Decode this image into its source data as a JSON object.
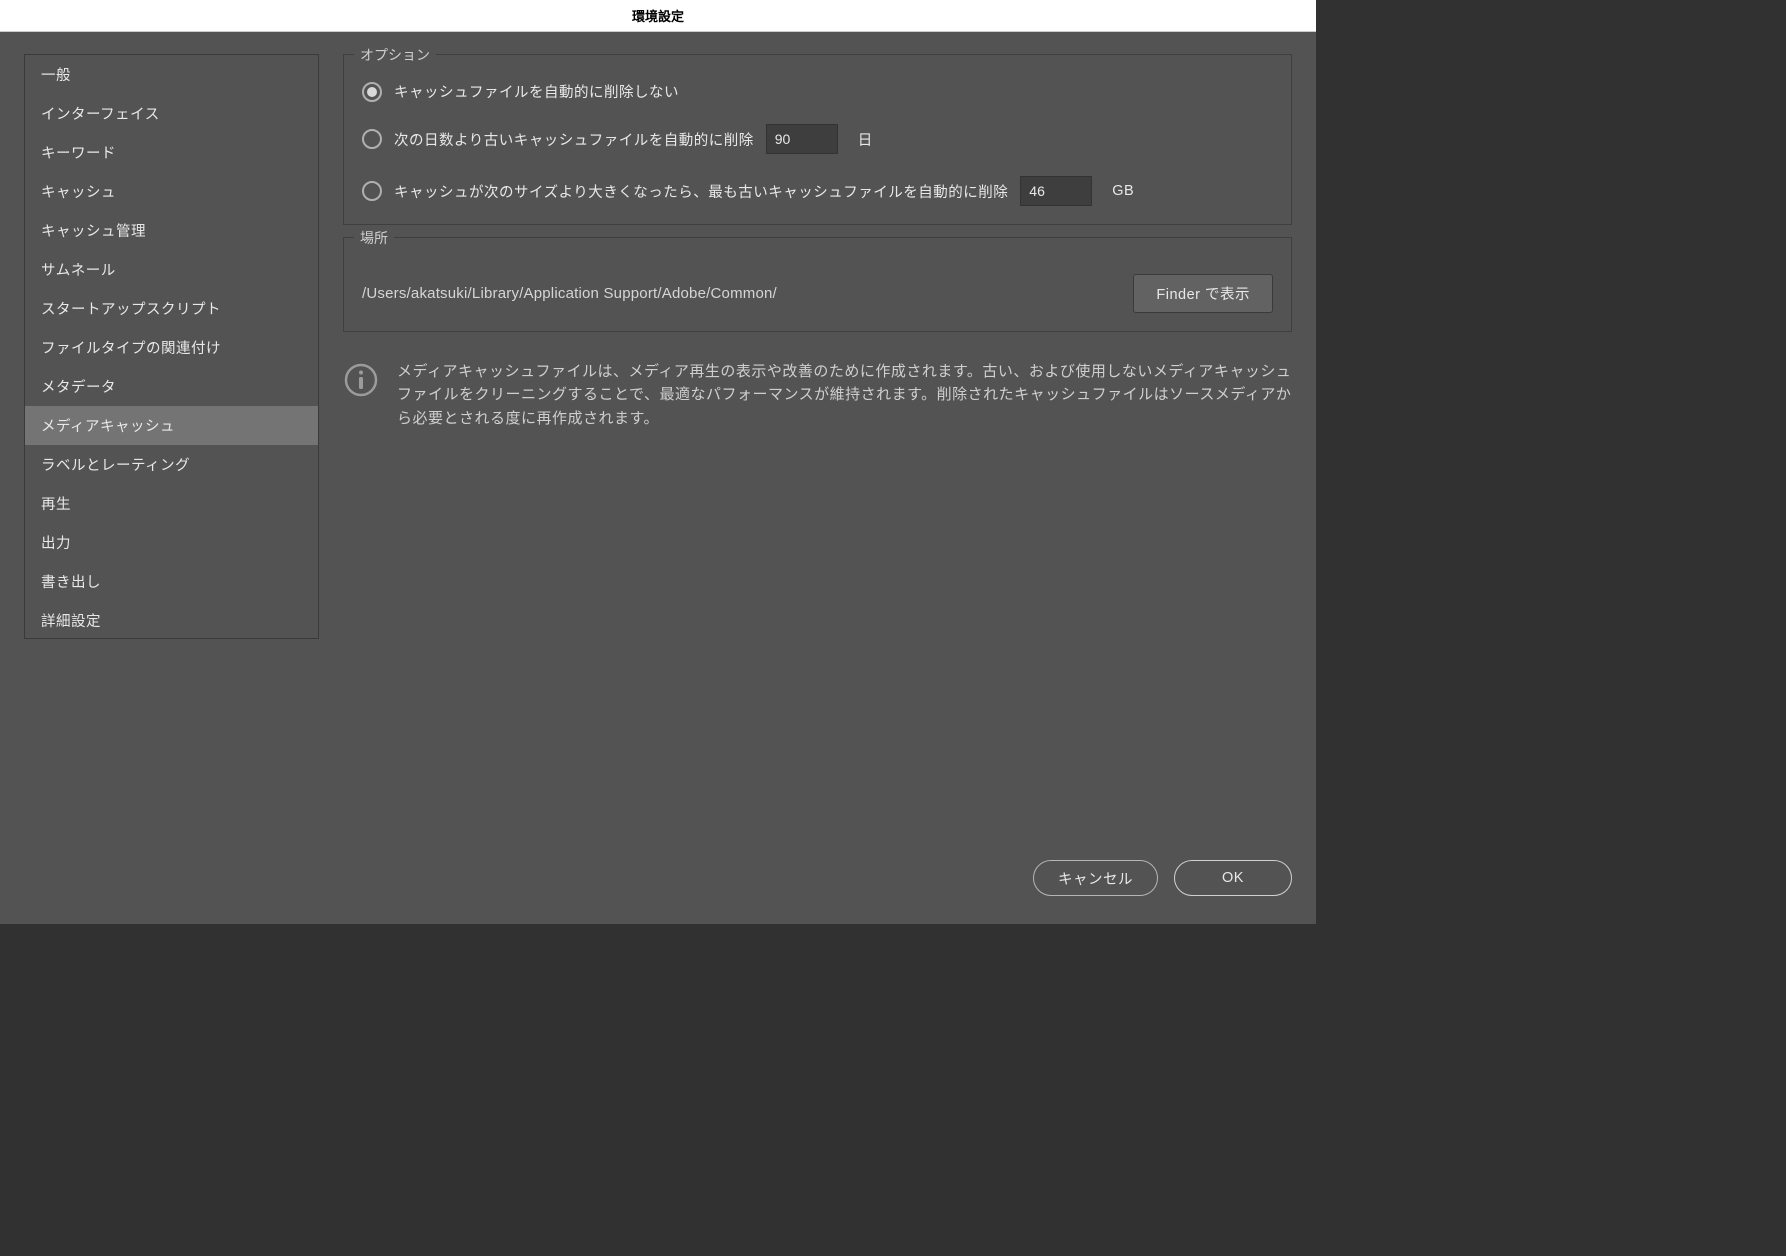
{
  "window": {
    "title": "環境設定"
  },
  "sidebar": {
    "items": [
      {
        "label": "一般"
      },
      {
        "label": "インターフェイス"
      },
      {
        "label": "キーワード"
      },
      {
        "label": "キャッシュ"
      },
      {
        "label": "キャッシュ管理"
      },
      {
        "label": "サムネール"
      },
      {
        "label": "スタートアップスクリプト"
      },
      {
        "label": "ファイルタイプの関連付け"
      },
      {
        "label": "メタデータ"
      },
      {
        "label": "メディアキャッシュ"
      },
      {
        "label": "ラベルとレーティング"
      },
      {
        "label": "再生"
      },
      {
        "label": "出力"
      },
      {
        "label": "書き出し"
      },
      {
        "label": "詳細設定"
      }
    ],
    "selected_index": 9
  },
  "panel": {
    "options_legend": "オプション",
    "radio1_label": "キャッシュファイルを自動的に削除しない",
    "radio2_label": "次の日数より古いキャッシュファイルを自動的に削除",
    "radio2_value": "90",
    "radio2_unit": "日",
    "radio3_label": "キャッシュが次のサイズより大きくなったら、最も古いキャッシュファイルを自動的に削除",
    "radio3_value": "46",
    "radio3_unit": "GB",
    "selected_radio": 0,
    "location_legend": "場所",
    "location_path": "/Users/akatsuki/Library/Application Support/Adobe/Common/",
    "finder_button": "Finder で表示",
    "info_text": "メディアキャッシュファイルは、メディア再生の表示や改善のために作成されます。古い、および使用しないメディアキャッシュファイルをクリーニングすることで、最適なパフォーマンスが維持されます。削除されたキャッシュファイルはソースメディアから必要とされる度に再作成されます。"
  },
  "footer": {
    "cancel": "キャンセル",
    "ok": "OK"
  }
}
